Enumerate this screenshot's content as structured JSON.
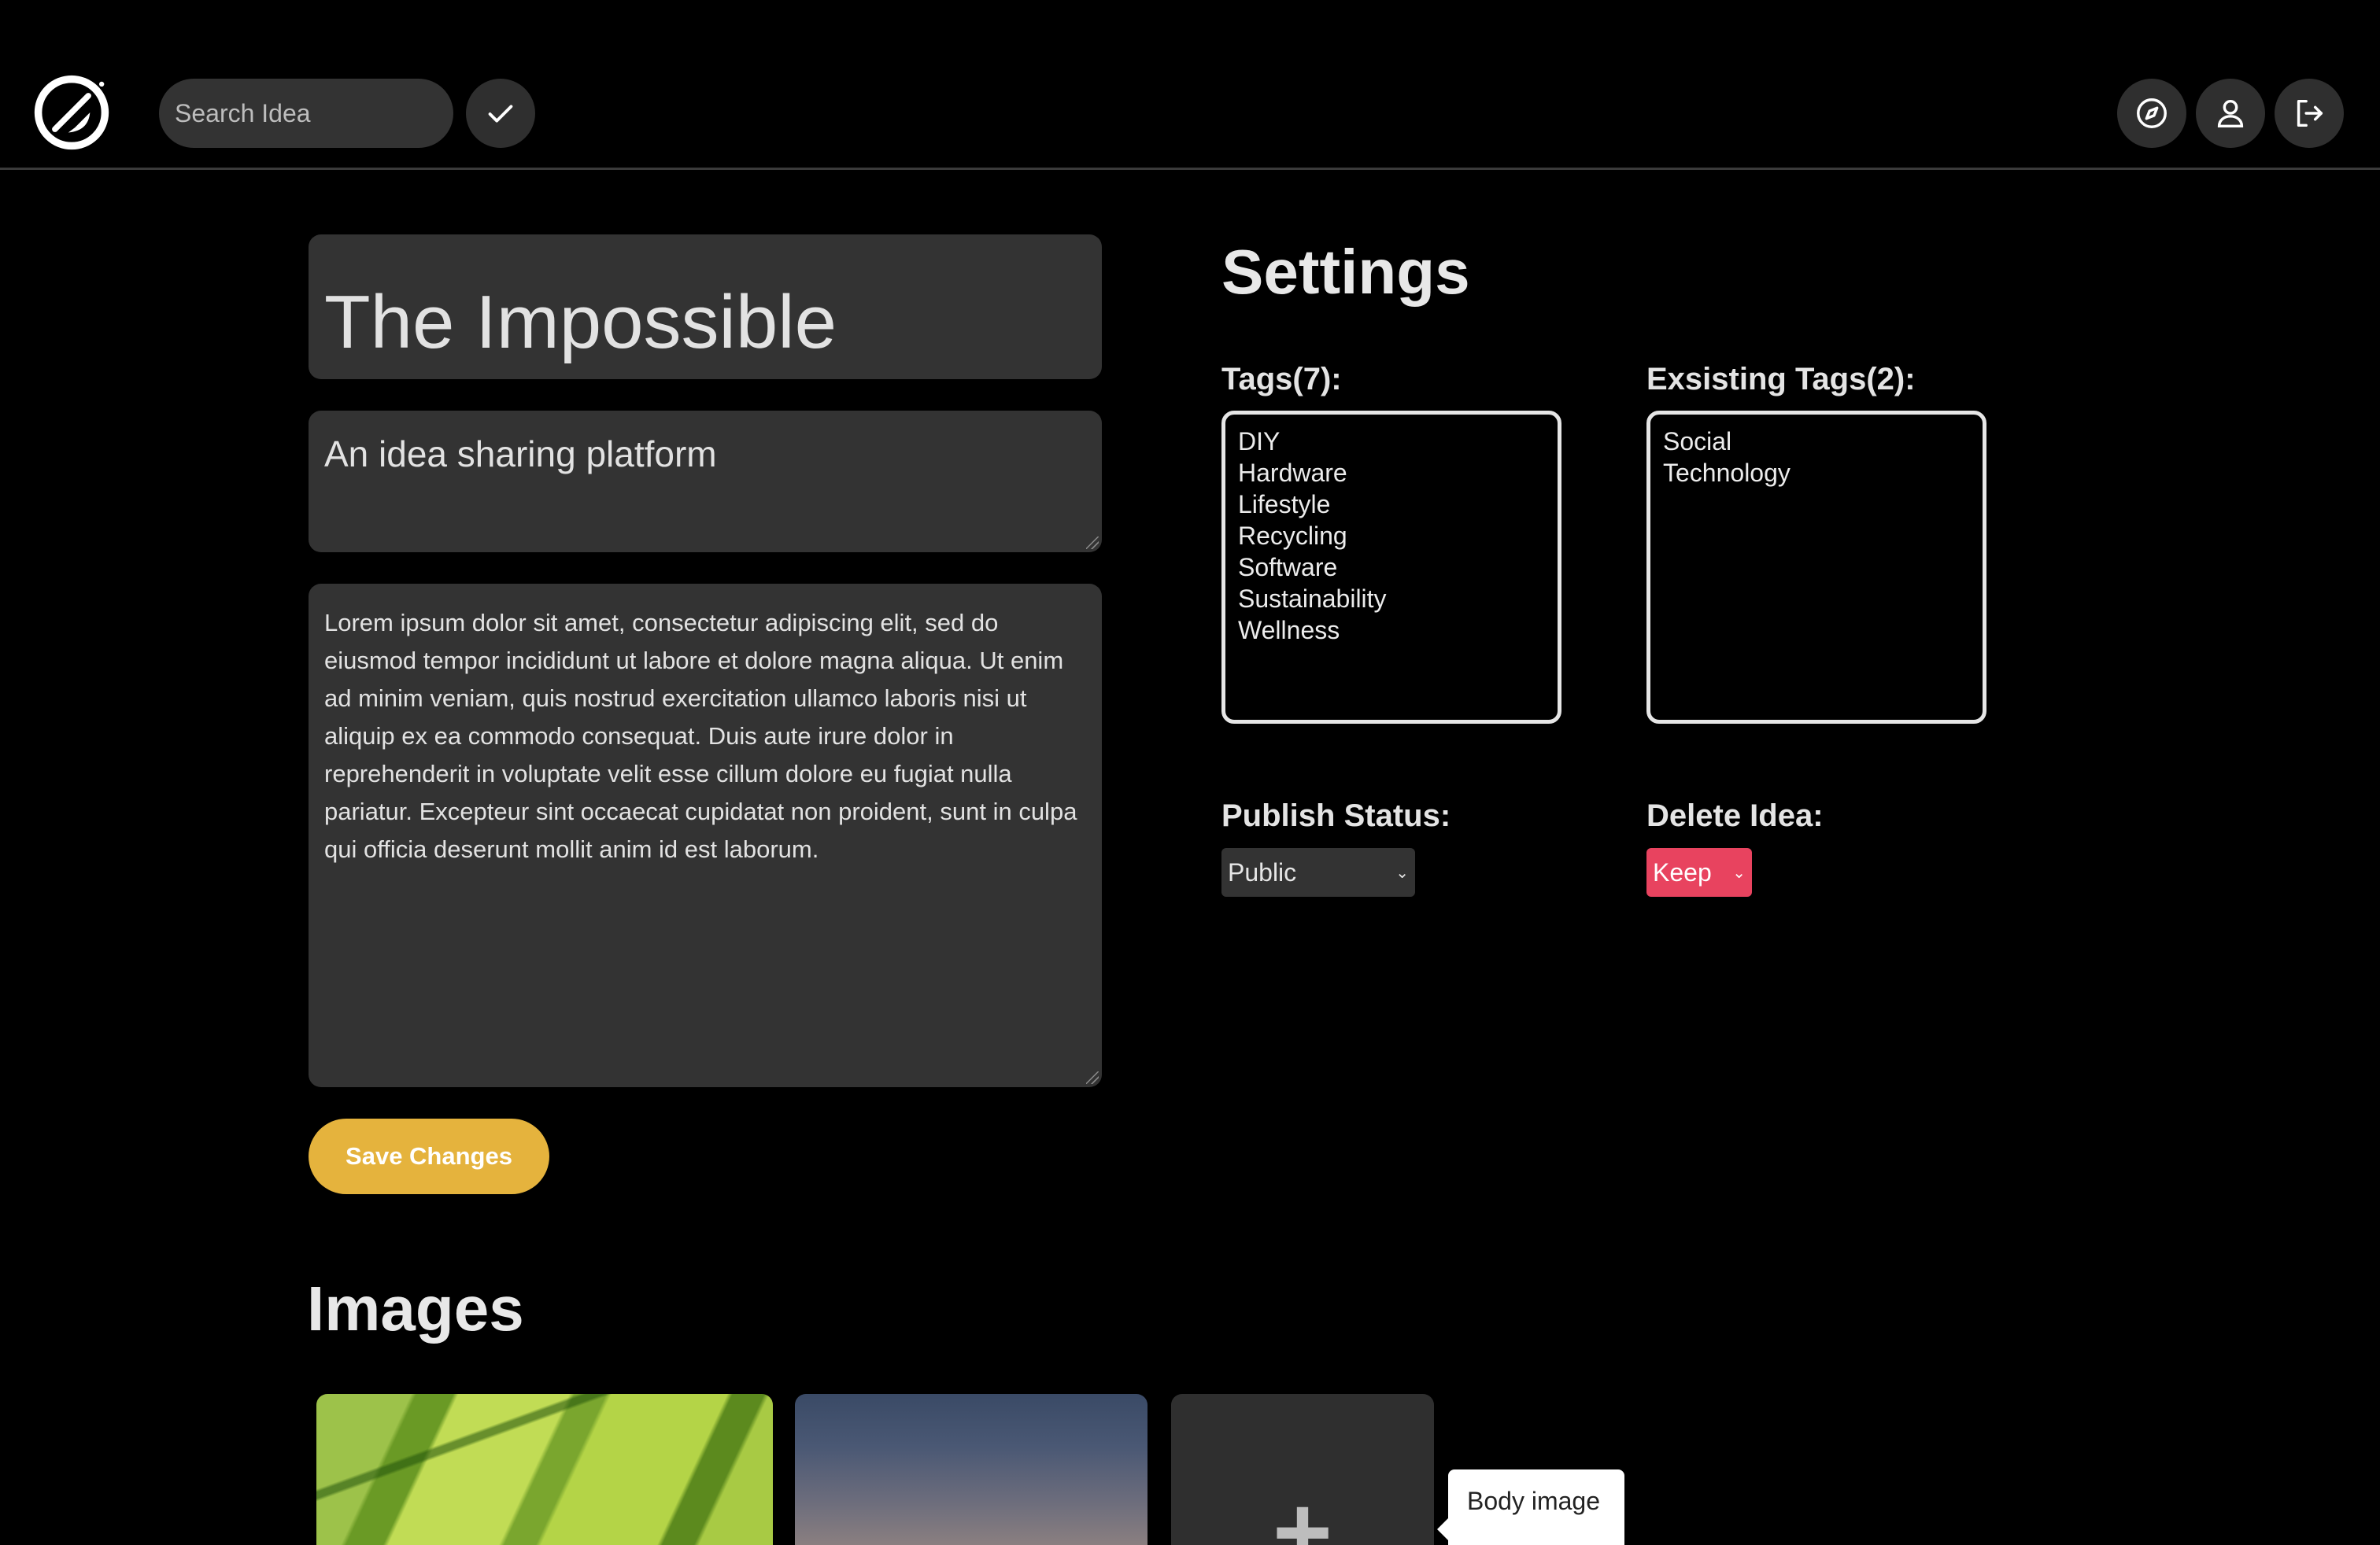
{
  "header": {
    "search": {
      "placeholder": "Search Idea",
      "value": ""
    },
    "icons": [
      "logo-icon",
      "check-icon",
      "compass-icon",
      "user-icon",
      "logout-icon"
    ]
  },
  "editor": {
    "title": "The Impossible",
    "subtitle": "An idea sharing platform",
    "body": "Lorem ipsum dolor sit amet, consectetur adipiscing elit, sed do eiusmod tempor incididunt ut labore et dolore magna aliqua. Ut enim ad minim veniam, quis nostrud exercitation ullamco laboris nisi ut aliquip ex ea commodo consequat. Duis aute irure dolor in reprehenderit in voluptate velit esse cillum dolore eu fugiat nulla pariatur. Excepteur sint occaecat cupidatat non proident, sunt in culpa qui officia deserunt mollit anim id est laborum.",
    "save_label": "Save Changes"
  },
  "settings": {
    "heading": "Settings",
    "tags_label": "Tags(7):",
    "tags": [
      "DIY",
      "Hardware",
      "Lifestyle",
      "Recycling",
      "Software",
      "Sustainability",
      "Wellness"
    ],
    "existing_label": "Exsisting Tags(2):",
    "existing_tags": [
      "Social",
      "Technology"
    ],
    "publish_label": "Publish Status:",
    "publish_value": "Public",
    "delete_label": "Delete Idea:",
    "delete_value": "Keep"
  },
  "images": {
    "heading": "Images",
    "tooltip": "Body image",
    "add_symbol": "+"
  },
  "colors": {
    "background": "#000000",
    "field_bg": "#333333",
    "accent_save": "#e5b33d",
    "delete_red": "#e8435f"
  }
}
